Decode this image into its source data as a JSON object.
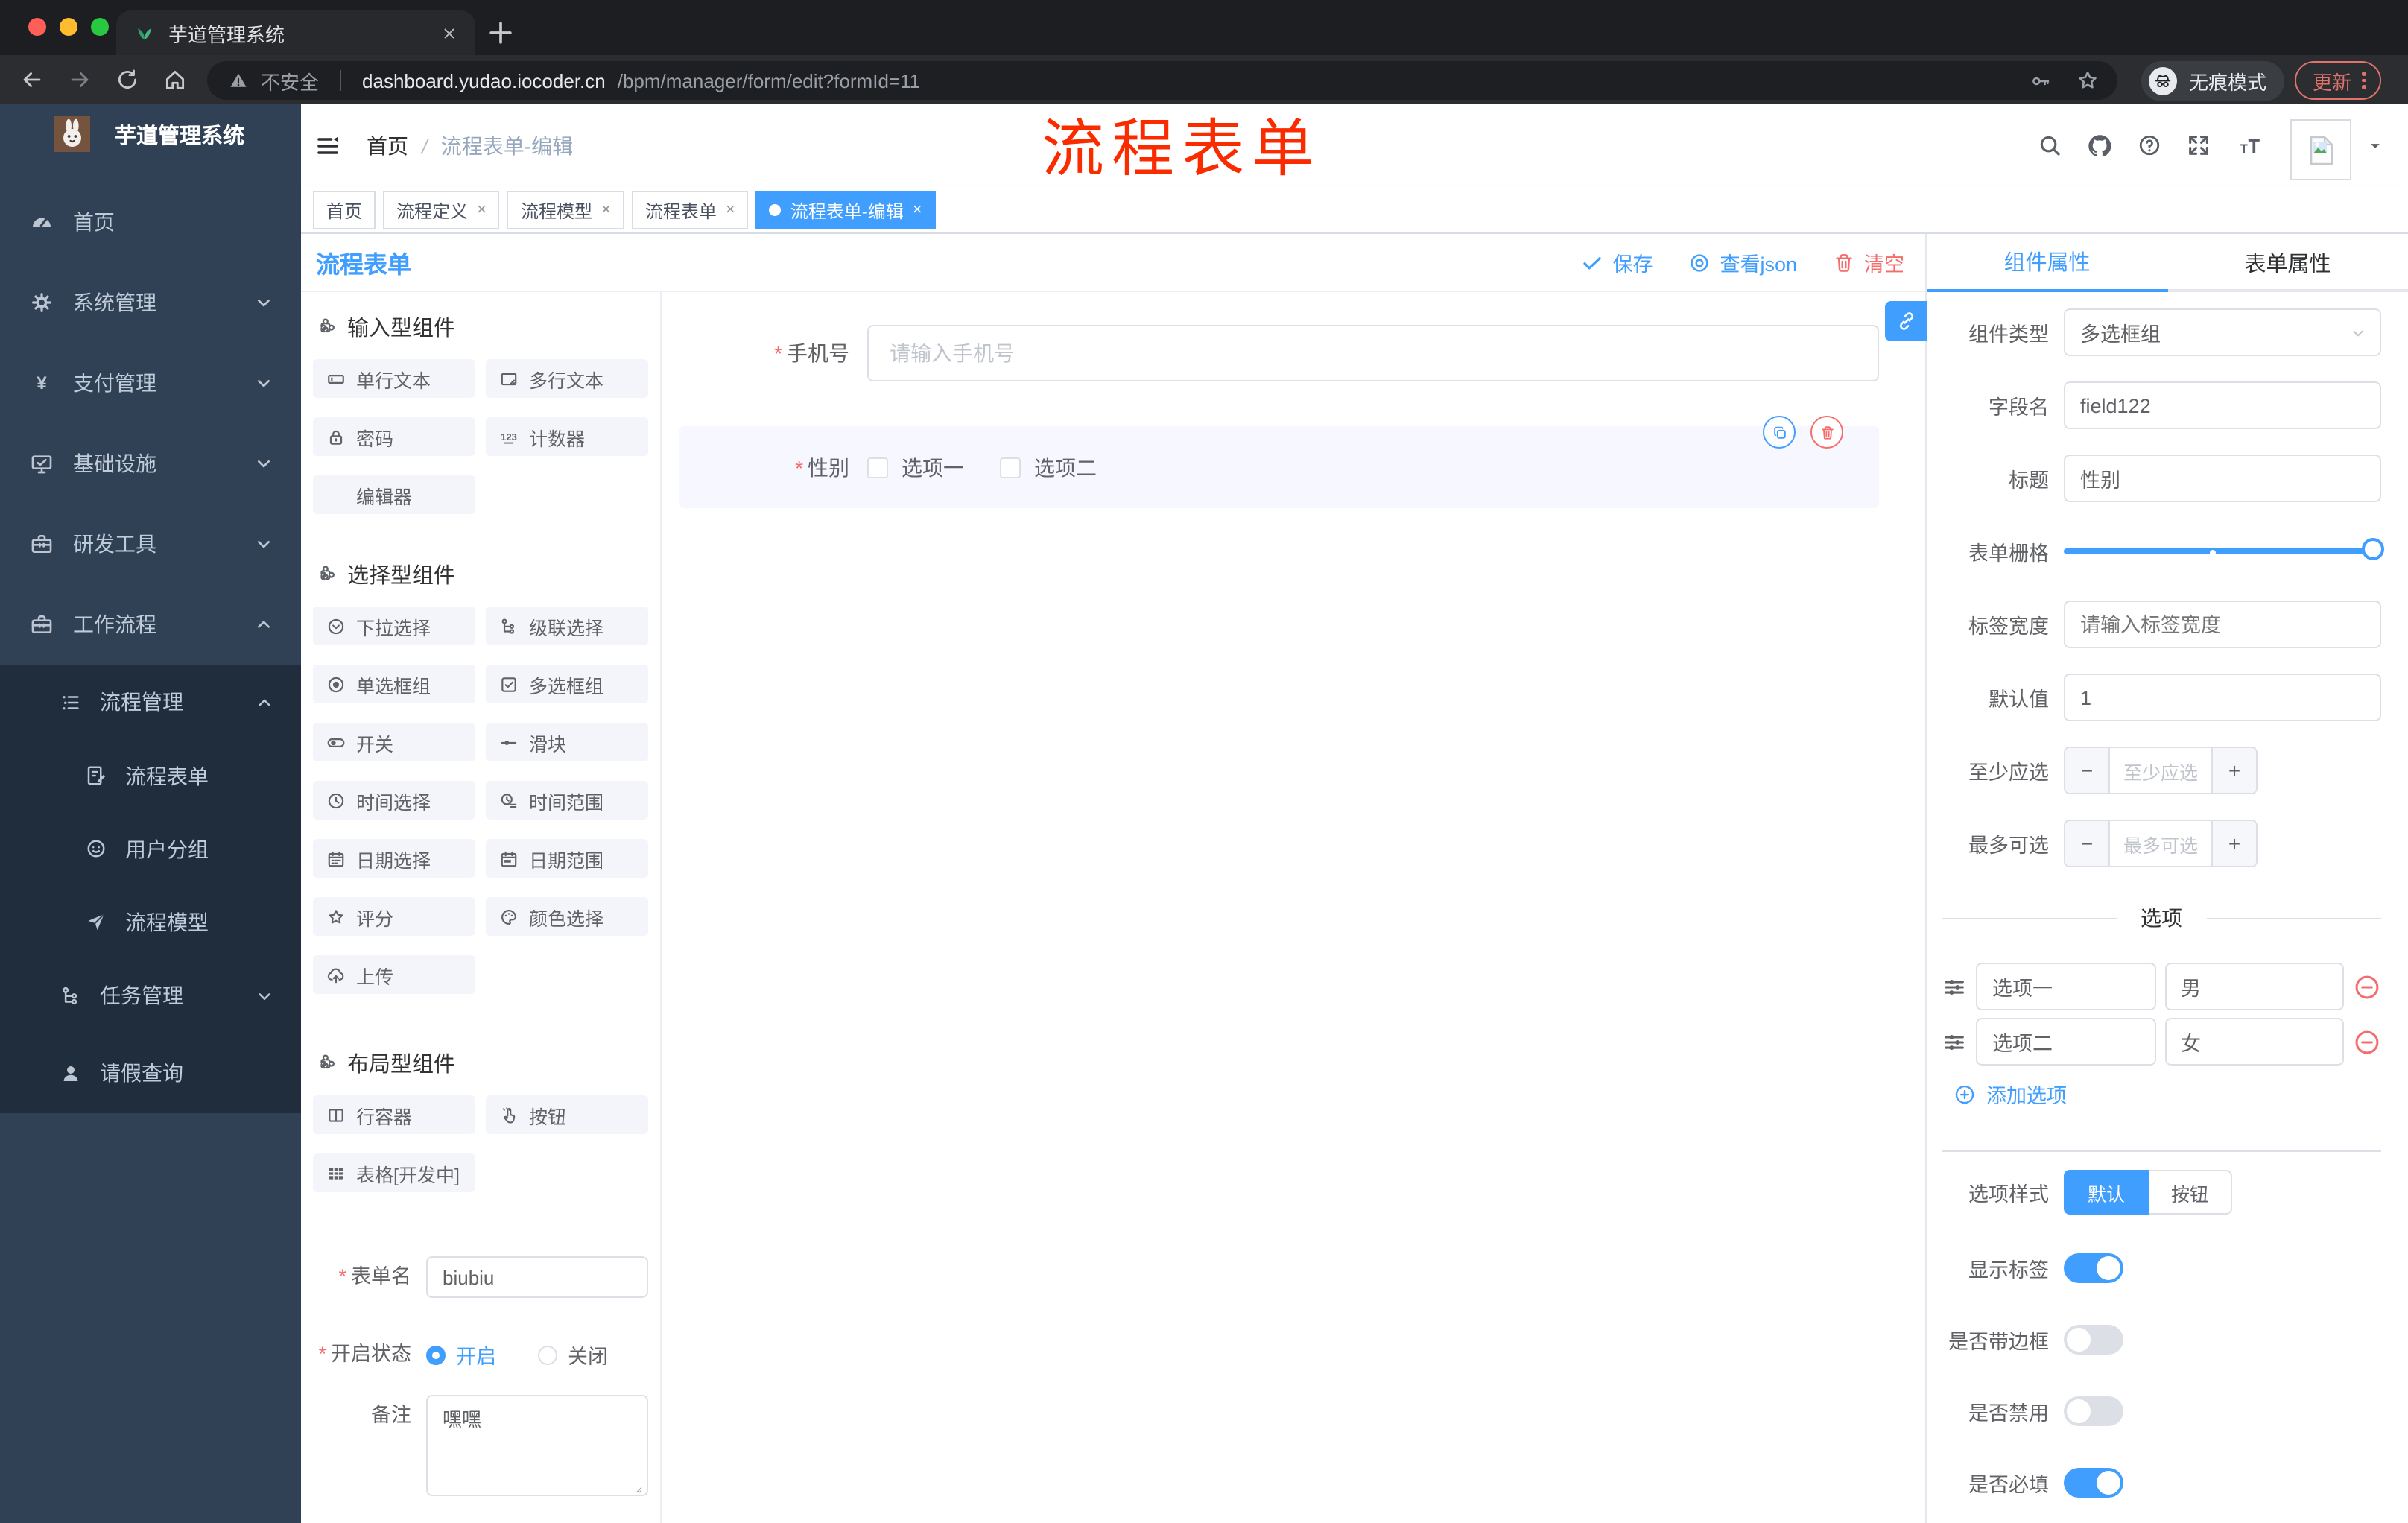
{
  "browser": {
    "tab_title": "芋道管理系统",
    "security": "不安全",
    "url_domain": "dashboard.yudao.iocoder.cn",
    "url_path": "/bpm/manager/form/edit?formId=11",
    "incognito": "无痕模式",
    "update": "更新"
  },
  "sidebar": {
    "brand": "芋道管理系统",
    "items": [
      {
        "label": "首页",
        "icon": "dashboard"
      },
      {
        "label": "系统管理",
        "icon": "gear"
      },
      {
        "label": "支付管理",
        "icon": "yen"
      },
      {
        "label": "基础设施",
        "icon": "monitor"
      },
      {
        "label": "研发工具",
        "icon": "toolbox"
      },
      {
        "label": "工作流程",
        "icon": "briefcase"
      },
      {
        "label": "流程管理",
        "icon": "list"
      },
      {
        "label": "流程表单",
        "icon": "doc-edit"
      },
      {
        "label": "用户分组",
        "icon": "face"
      },
      {
        "label": "流程模型",
        "icon": "send"
      },
      {
        "label": "任务管理",
        "icon": "tree"
      },
      {
        "label": "请假查询",
        "icon": "person"
      }
    ]
  },
  "header": {
    "breadcrumb": [
      "首页",
      "流程表单-编辑"
    ],
    "separator": "/",
    "annotation": "流程表单",
    "icons": [
      "search",
      "github",
      "help",
      "fullscreen",
      "textsize"
    ]
  },
  "tags": [
    {
      "label": "首页"
    },
    {
      "label": "流程定义"
    },
    {
      "label": "流程模型"
    },
    {
      "label": "流程表单"
    },
    {
      "label": "流程表单-编辑"
    }
  ],
  "designer": {
    "title": "流程表单",
    "actions": {
      "save": "保存",
      "view_json": "查看json",
      "clear": "清空"
    },
    "sections": [
      {
        "title": "输入型组件",
        "items": [
          {
            "label": "单行文本",
            "icon": "input"
          },
          {
            "label": "多行文本",
            "icon": "textarea"
          },
          {
            "label": "密码",
            "icon": "lock"
          },
          {
            "label": "计数器",
            "icon": "counter"
          },
          {
            "label": "编辑器",
            "icon": ""
          }
        ]
      },
      {
        "title": "选择型组件",
        "items": [
          {
            "label": "下拉选择",
            "icon": "select"
          },
          {
            "label": "级联选择",
            "icon": "cascade"
          },
          {
            "label": "单选框组",
            "icon": "radio"
          },
          {
            "label": "多选框组",
            "icon": "checkbox"
          },
          {
            "label": "开关",
            "icon": "switch"
          },
          {
            "label": "滑块",
            "icon": "slider"
          },
          {
            "label": "时间选择",
            "icon": "clock"
          },
          {
            "label": "时间范围",
            "icon": "time-range"
          },
          {
            "label": "日期选择",
            "icon": "calendar"
          },
          {
            "label": "日期范围",
            "icon": "calendar-range"
          },
          {
            "label": "评分",
            "icon": "star"
          },
          {
            "label": "颜色选择",
            "icon": "palette"
          },
          {
            "label": "上传",
            "icon": "upload"
          }
        ]
      },
      {
        "title": "布局型组件",
        "items": [
          {
            "label": "行容器",
            "icon": "columns"
          },
          {
            "label": "按钮",
            "icon": "click"
          },
          {
            "label": "表格[开发中]",
            "icon": "table"
          }
        ]
      }
    ],
    "meta_form": {
      "name_label": "表单名",
      "name_value": "biubiu",
      "status_label": "开启状态",
      "status_on": "开启",
      "status_off": "关闭",
      "remark_label": "备注",
      "remark_value": "嘿嘿"
    }
  },
  "canvas": {
    "phone": {
      "label": "手机号",
      "placeholder": "请输入手机号"
    },
    "gender": {
      "label": "性别",
      "option1": "选项一",
      "option2": "选项二"
    }
  },
  "panel": {
    "tabs": [
      "组件属性",
      "表单属性"
    ],
    "fields": {
      "type_label": "组件类型",
      "type_value": "多选框组",
      "field_label": "字段名",
      "field_value": "field122",
      "title_label": "标题",
      "title_value": "性别",
      "grid_label": "表单栅格",
      "label_width_label": "标签宽度",
      "label_width_placeholder": "请输入标签宽度",
      "default_label": "默认值",
      "default_value": "1",
      "min_label": "至少应选",
      "min_placeholder": "至少应选",
      "max_label": "最多可选",
      "max_placeholder": "最多可选"
    },
    "options_divider": "选项",
    "options": [
      {
        "label": "选项一",
        "value": "男"
      },
      {
        "label": "选项二",
        "value": "女"
      }
    ],
    "add_option": "添加选项",
    "style_label": "选项样式",
    "style_default": "默认",
    "style_button": "按钮",
    "toggles": [
      {
        "label": "显示标签",
        "on": true
      },
      {
        "label": "是否带边框",
        "on": false
      },
      {
        "label": "是否禁用",
        "on": false
      },
      {
        "label": "是否必填",
        "on": true
      }
    ]
  },
  "colors": {
    "accent": "#409eff",
    "danger": "#f56c6c",
    "annotation_red": "#fb2b00",
    "sidebar_bg": "#304156",
    "submenu_bg": "#1f2d3d"
  }
}
